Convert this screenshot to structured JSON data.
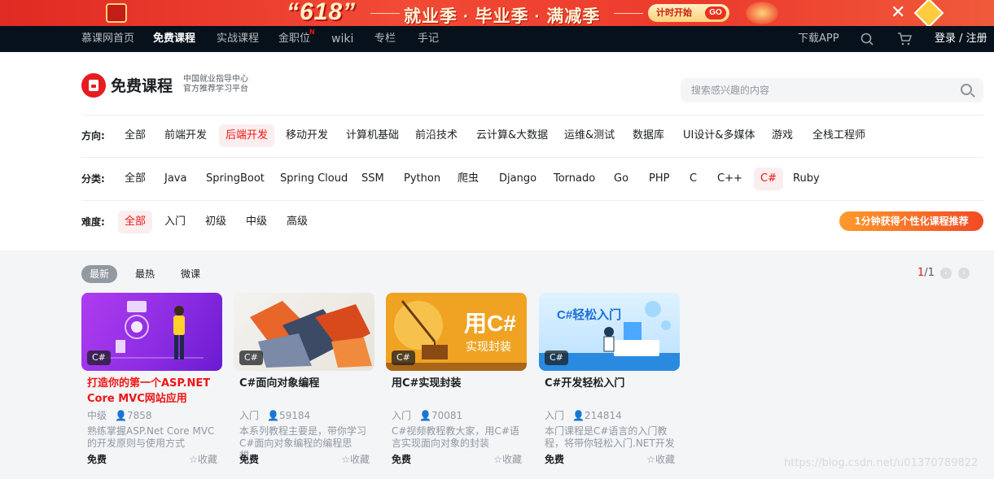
{
  "banner": {
    "badge": "“618”",
    "slogan": "就业季 · 毕业季 · 满减季",
    "cta": "计时开始",
    "cta_go": "GO",
    "close": "✕"
  },
  "topnav": {
    "items": [
      "慕课网首页",
      "免费课程",
      "实战课程",
      "金职位",
      "wiki",
      "专栏",
      "手记"
    ],
    "new_badge": "N",
    "download": "下载APP",
    "login": "登录 / 注册"
  },
  "header": {
    "title": "免费课程",
    "subtitle_line1": "中国就业指导中心",
    "subtitle_line2": "官方推荐学习平台",
    "search_placeholder": "搜索感兴趣的内容"
  },
  "filters": {
    "direction": {
      "label": "方向:",
      "options": [
        "全部",
        "前端开发",
        "后端开发",
        "移动开发",
        "计算机基础",
        "前沿技术",
        "云计算&大数据",
        "运维&测试",
        "数据库",
        "UI设计&多媒体",
        "游戏",
        "全栈工程师"
      ],
      "selected": "后端开发"
    },
    "category": {
      "label": "分类:",
      "options": [
        "全部",
        "Java",
        "SpringBoot",
        "Spring Cloud",
        "SSM",
        "Python",
        "爬虫",
        "Django",
        "Tornado",
        "Go",
        "PHP",
        "C",
        "C++",
        "C#",
        "Ruby"
      ],
      "selected": "C#"
    },
    "difficulty": {
      "label": "难度:",
      "options": [
        "全部",
        "入门",
        "初级",
        "中级",
        "高级"
      ],
      "selected": "全部"
    },
    "recommend_button": "1分钟获得个性化课程推荐"
  },
  "sort": {
    "options": [
      "最新",
      "最热",
      "微课"
    ],
    "selected": "最新"
  },
  "pager": {
    "current": "1",
    "total": "/1"
  },
  "courses": [
    {
      "tag": "C#",
      "title": "打造你的第一个ASP.NET Core MVC网站应用",
      "title_red": true,
      "level": "中级",
      "learners": "7858",
      "desc": "熟练掌握ASP.Net Core MVC的开发原则与使用方式",
      "price": "免费",
      "fav": "收藏"
    },
    {
      "tag": "C#",
      "title": "C#面向对象编程",
      "title_red": false,
      "level": "入门",
      "learners": "59184",
      "desc": "本系列教程主要是，带你学习C#面向对象编程的编程思想…",
      "price": "免费",
      "fav": "收藏"
    },
    {
      "tag": "C#",
      "title": "用C#实现封装",
      "title_red": false,
      "level": "入门",
      "learners": "70081",
      "desc": "C#视频教程教大家，用C#语言实现面向对象的封装",
      "price": "免费",
      "fav": "收藏",
      "thumb_big": "用C#",
      "thumb_small": "实现封装"
    },
    {
      "tag": "C#",
      "title": "C#开发轻松入门",
      "title_red": false,
      "level": "入门",
      "learners": "214814",
      "desc": "本门课程是C#语言的入门教程，将带你轻松入门.NET开发",
      "price": "免费",
      "fav": "收藏",
      "thumb_title": "C#轻松入门"
    }
  ],
  "watermark": "https://blog.csdn.net/u013707​89822",
  "colors": {
    "accent": "#f01414",
    "topbar": "#07111b",
    "brand": "#e61c21"
  }
}
